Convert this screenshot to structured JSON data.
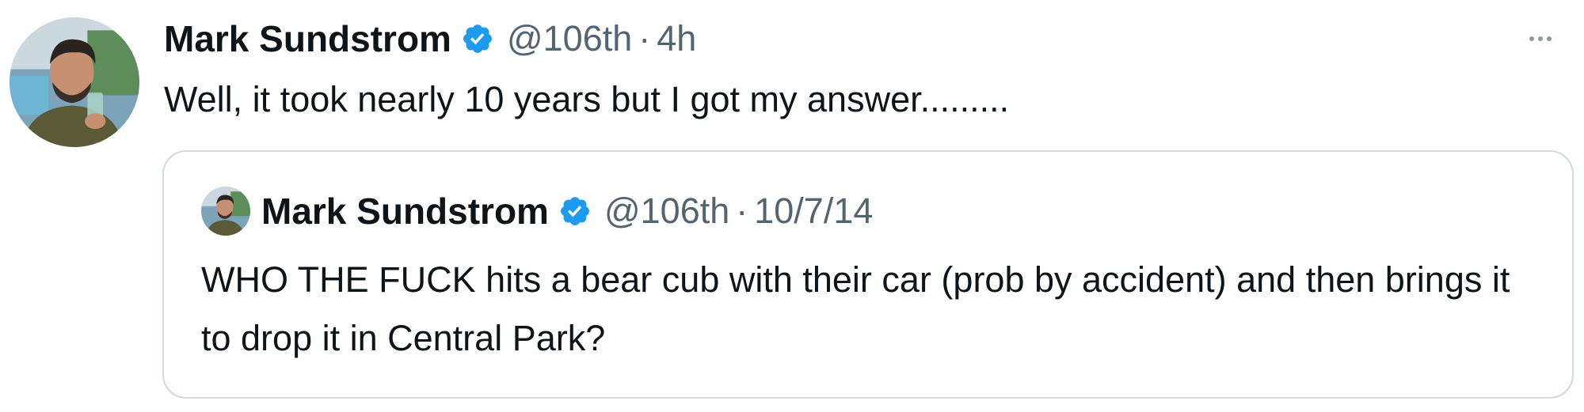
{
  "tweet": {
    "author_name": "Mark Sundstrom",
    "handle": "@106th",
    "separator": "·",
    "time": "4h",
    "text": "Well, it took nearly 10 years but I got my answer.........",
    "verified_color": "#1d9bf0"
  },
  "quoted_tweet": {
    "author_name": "Mark Sundstrom",
    "handle": "@106th",
    "separator": "·",
    "time": "10/7/14",
    "text": "WHO THE FUCK hits a bear cub with their car (prob by accident) and then brings it to drop it in Central Park?"
  },
  "icons": [
    "avatar-photo",
    "verified-badge-icon",
    "more-options-icon"
  ]
}
